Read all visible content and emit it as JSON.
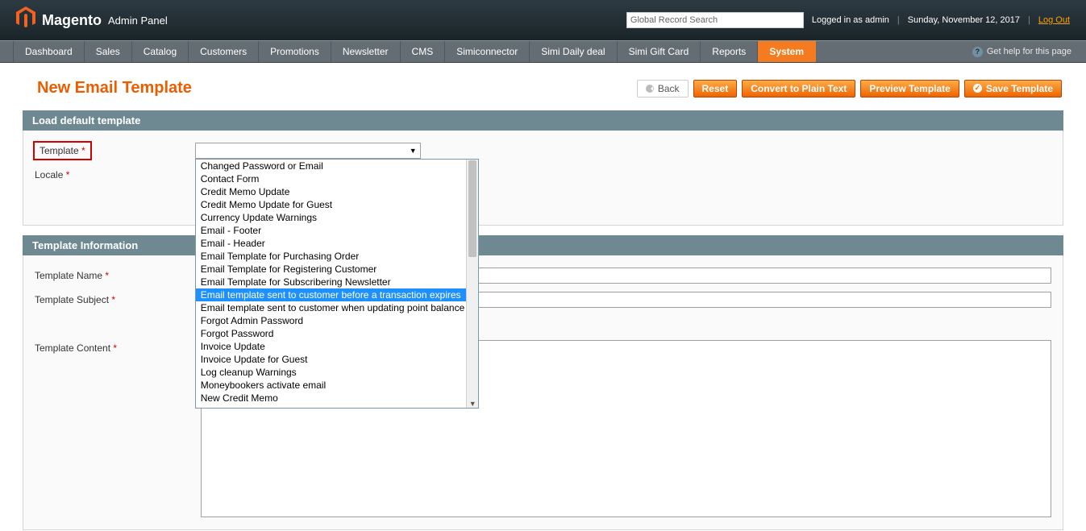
{
  "header": {
    "brand": "Magento",
    "brand_sub": "Admin Panel",
    "search_placeholder": "Global Record Search",
    "logged_in": "Logged in as admin",
    "date": "Sunday, November 12, 2017",
    "logout": "Log Out"
  },
  "nav": {
    "items": [
      "Dashboard",
      "Sales",
      "Catalog",
      "Customers",
      "Promotions",
      "Newsletter",
      "CMS",
      "Simiconnector",
      "Simi Daily deal",
      "Simi Gift Card",
      "Reports",
      "System"
    ],
    "active_index": 11,
    "help": "Get help for this page"
  },
  "page": {
    "title": "New Email Template",
    "buttons": {
      "back": "Back",
      "reset": "Reset",
      "convert": "Convert to Plain Text",
      "preview": "Preview Template",
      "save": "Save Template"
    }
  },
  "section1": {
    "title": "Load default template",
    "fields": {
      "template": "Template",
      "locale": "Locale"
    }
  },
  "section2": {
    "title": "Template Information",
    "fields": {
      "name": "Template Name",
      "subject": "Template Subject",
      "content": "Template Content"
    }
  },
  "dropdown": {
    "selected_index": 9,
    "options": [
      "Changed Password or Email",
      "Contact Form",
      "Credit Memo Update",
      "Credit Memo Update for Guest",
      "Currency Update Warnings",
      "Email - Footer",
      "Email - Header",
      "Email Template for Purchasing Order",
      "Email Template for Registering Customer",
      "Email Template for Subscribering Newsletter",
      "Email template sent to customer before a transaction expires",
      "Email template sent to customer when updating point balance",
      "Forgot Admin Password",
      "Forgot Password",
      "Invoice Update",
      "Invoice Update for Guest",
      "Log cleanup Warnings",
      "Moneybookers activate email",
      "New Credit Memo"
    ]
  }
}
